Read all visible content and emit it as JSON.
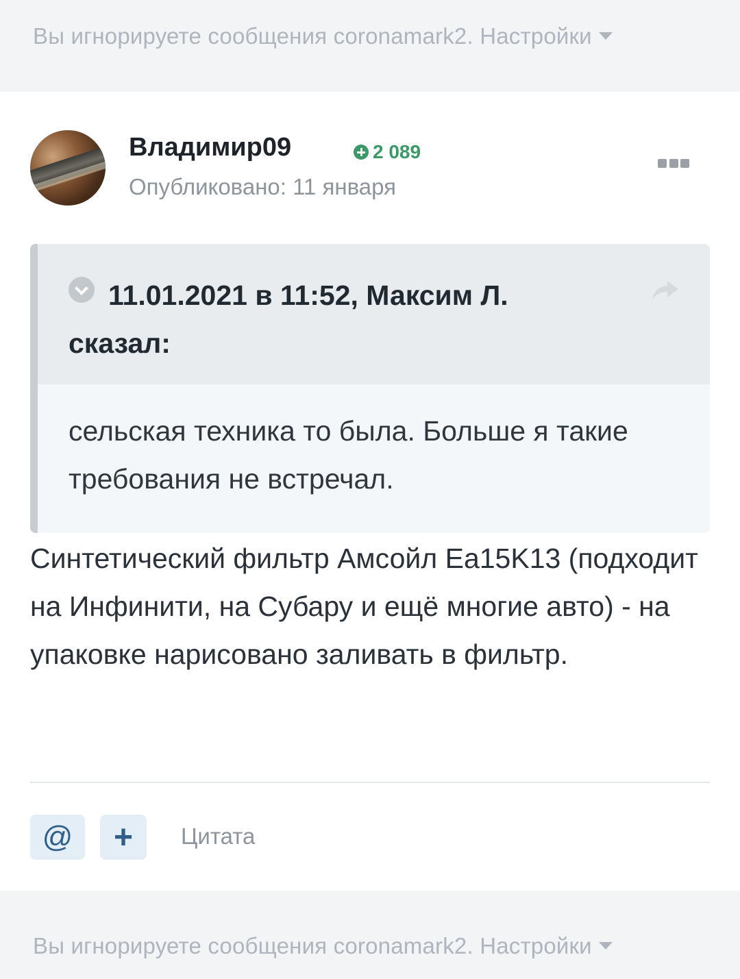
{
  "ignored_notice": {
    "text": "Вы игнорируете сообщения coronamark2. Настройки"
  },
  "post": {
    "author": "Владимир09",
    "reputation": "2 089",
    "published": "Опубликовано: 11 января",
    "quote": {
      "citation": "11.01.2021 в 11:52, Максим Л. сказал:",
      "text": "сельская техника то была. Больше я такие требования не встречал."
    },
    "content": "Синтетический фильтр Амсойл Ea15K13 (подходит на Инфинити, на Субару и ещё многие авто) - на упаковке нарисовано заливать в фильтр.",
    "actions": {
      "mention_label": "@",
      "plus_label": "+",
      "quote_label": "Цитата"
    }
  },
  "colors": {
    "reputation": "#3a9a67",
    "button_bg": "#e3eef7",
    "muted_text": "#aeb5bd"
  }
}
